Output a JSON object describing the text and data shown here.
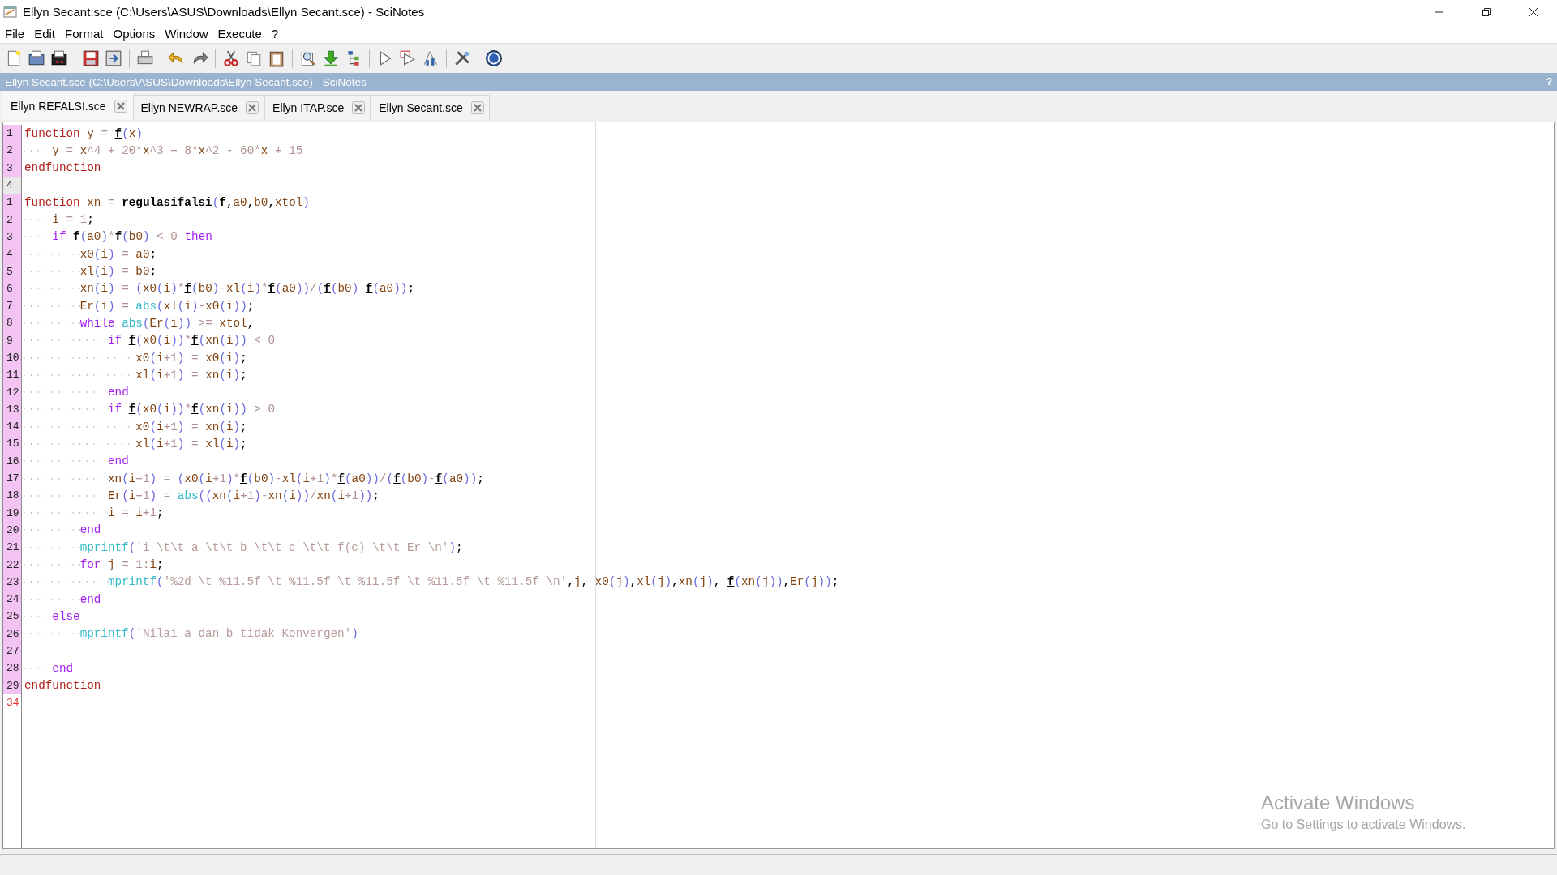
{
  "window": {
    "title": "Ellyn Secant.sce (C:\\Users\\ASUS\\Downloads\\Ellyn Secant.sce) - SciNotes"
  },
  "menu": [
    "File",
    "Edit",
    "Format",
    "Options",
    "Window",
    "Execute",
    "?"
  ],
  "info_bar": {
    "text": "Ellyn Secant.sce (C:\\Users\\ASUS\\Downloads\\Ellyn Secant.sce) - SciNotes",
    "help": "?"
  },
  "tabs": [
    {
      "label": "Ellyn REFALSI.sce",
      "selected": true
    },
    {
      "label": "Ellyn NEWRAP.sce",
      "selected": false
    },
    {
      "label": "Ellyn ITAP.sce",
      "selected": false
    },
    {
      "label": "Ellyn Secant.sce",
      "selected": false
    }
  ],
  "editor": {
    "lines": [
      {
        "number": "1",
        "kind": "normal",
        "tokens": [
          {
            "kind": "keyword",
            "text": "function "
          },
          {
            "kind": "variable",
            "text": "y"
          },
          {
            "kind": "literal",
            "text": " = "
          },
          {
            "kind": "call",
            "text": "f"
          },
          {
            "kind": "bracket",
            "text": "("
          },
          {
            "kind": "variable",
            "text": "x"
          },
          {
            "kind": "bracket",
            "text": ")"
          }
        ]
      },
      {
        "number": "2",
        "kind": "normal",
        "tokens": [
          {
            "kind": "variable",
            "text": "    y"
          },
          {
            "kind": "literal",
            "text": " = "
          },
          {
            "kind": "variable",
            "text": "x"
          },
          {
            "kind": "literal",
            "text": "^4 + 20*"
          },
          {
            "kind": "variable",
            "text": "x"
          },
          {
            "kind": "literal",
            "text": "^3 + 8*"
          },
          {
            "kind": "variable",
            "text": "x"
          },
          {
            "kind": "literal",
            "text": "^2 - 60*"
          },
          {
            "kind": "variable",
            "text": "x"
          },
          {
            "kind": "literal",
            "text": " + 15"
          }
        ]
      },
      {
        "number": "3",
        "kind": "normal",
        "tokens": [
          {
            "kind": "keyword",
            "text": "endfunction"
          }
        ]
      },
      {
        "number": "4",
        "kind": "plain"
      },
      {
        "number": "1",
        "kind": "normal",
        "tokens": [
          {
            "kind": "keyword",
            "text": "function "
          },
          {
            "kind": "variable",
            "text": "xn"
          },
          {
            "kind": "literal",
            "text": " = "
          },
          {
            "kind": "call",
            "text": "regulasifalsi"
          },
          {
            "kind": "bracket",
            "text": "("
          },
          {
            "kind": "call",
            "text": "f"
          },
          {
            "kind": "plain",
            "text": ","
          },
          {
            "kind": "variable",
            "text": "a0"
          },
          {
            "kind": "plain",
            "text": ","
          },
          {
            "kind": "variable",
            "text": "b0"
          },
          {
            "kind": "plain",
            "text": ","
          },
          {
            "kind": "variable",
            "text": "xtol"
          },
          {
            "kind": "bracket",
            "text": ")"
          }
        ]
      },
      {
        "number": "2",
        "kind": "normal",
        "tokens": [
          {
            "kind": "variable",
            "text": "    i"
          },
          {
            "kind": "literal",
            "text": " = 1"
          },
          {
            "kind": "plain",
            "text": ";"
          }
        ]
      },
      {
        "number": "3",
        "kind": "normal",
        "tokens": [
          {
            "kind": "control",
            "text": "    if "
          },
          {
            "kind": "call",
            "text": "f"
          },
          {
            "kind": "bracket",
            "text": "("
          },
          {
            "kind": "variable",
            "text": "a0"
          },
          {
            "kind": "bracket",
            "text": ")"
          },
          {
            "kind": "literal",
            "text": "*"
          },
          {
            "kind": "call",
            "text": "f"
          },
          {
            "kind": "bracket",
            "text": "("
          },
          {
            "kind": "variable",
            "text": "b0"
          },
          {
            "kind": "bracket",
            "text": ")"
          },
          {
            "kind": "literal",
            "text": " < 0 "
          },
          {
            "kind": "control",
            "text": "then"
          }
        ]
      },
      {
        "number": "4",
        "kind": "normal",
        "tokens": [
          {
            "kind": "variable",
            "text": "        x0"
          },
          {
            "kind": "bracket",
            "text": "("
          },
          {
            "kind": "variable",
            "text": "i"
          },
          {
            "kind": "bracket",
            "text": ")"
          },
          {
            "kind": "literal",
            "text": " = "
          },
          {
            "kind": "variable",
            "text": "a0"
          },
          {
            "kind": "plain",
            "text": ";"
          }
        ]
      },
      {
        "number": "5",
        "kind": "normal",
        "tokens": [
          {
            "kind": "variable",
            "text": "        xl"
          },
          {
            "kind": "bracket",
            "text": "("
          },
          {
            "kind": "variable",
            "text": "i"
          },
          {
            "kind": "bracket",
            "text": ")"
          },
          {
            "kind": "literal",
            "text": " = "
          },
          {
            "kind": "variable",
            "text": "b0"
          },
          {
            "kind": "plain",
            "text": ";"
          }
        ]
      },
      {
        "number": "6",
        "kind": "normal",
        "tokens": [
          {
            "kind": "variable",
            "text": "        xn"
          },
          {
            "kind": "bracket",
            "text": "("
          },
          {
            "kind": "variable",
            "text": "i"
          },
          {
            "kind": "bracket",
            "text": ")"
          },
          {
            "kind": "literal",
            "text": " = "
          },
          {
            "kind": "bracket",
            "text": "("
          },
          {
            "kind": "variable",
            "text": "x0"
          },
          {
            "kind": "bracket",
            "text": "("
          },
          {
            "kind": "variable",
            "text": "i"
          },
          {
            "kind": "bracket",
            "text": ")"
          },
          {
            "kind": "literal",
            "text": "*"
          },
          {
            "kind": "call",
            "text": "f"
          },
          {
            "kind": "bracket",
            "text": "("
          },
          {
            "kind": "variable",
            "text": "b0"
          },
          {
            "kind": "bracket",
            "text": ")"
          },
          {
            "kind": "literal",
            "text": "-"
          },
          {
            "kind": "variable",
            "text": "xl"
          },
          {
            "kind": "bracket",
            "text": "("
          },
          {
            "kind": "variable",
            "text": "i"
          },
          {
            "kind": "bracket",
            "text": ")"
          },
          {
            "kind": "literal",
            "text": "*"
          },
          {
            "kind": "call",
            "text": "f"
          },
          {
            "kind": "bracket",
            "text": "("
          },
          {
            "kind": "variable",
            "text": "a0"
          },
          {
            "kind": "bracket",
            "text": "))"
          },
          {
            "kind": "literal",
            "text": "/"
          },
          {
            "kind": "bracket",
            "text": "("
          },
          {
            "kind": "call",
            "text": "f"
          },
          {
            "kind": "bracket",
            "text": "("
          },
          {
            "kind": "variable",
            "text": "b0"
          },
          {
            "kind": "bracket",
            "text": ")"
          },
          {
            "kind": "literal",
            "text": "-"
          },
          {
            "kind": "call",
            "text": "f"
          },
          {
            "kind": "bracket",
            "text": "("
          },
          {
            "kind": "variable",
            "text": "a0"
          },
          {
            "kind": "bracket",
            "text": "))"
          },
          {
            "kind": "plain",
            "text": ";"
          }
        ]
      },
      {
        "number": "7",
        "kind": "normal",
        "tokens": [
          {
            "kind": "variable",
            "text": "        Er"
          },
          {
            "kind": "bracket",
            "text": "("
          },
          {
            "kind": "variable",
            "text": "i"
          },
          {
            "kind": "bracket",
            "text": ")"
          },
          {
            "kind": "literal",
            "text": " = "
          },
          {
            "kind": "builtin",
            "text": "abs"
          },
          {
            "kind": "bracket",
            "text": "("
          },
          {
            "kind": "variable",
            "text": "xl"
          },
          {
            "kind": "bracket",
            "text": "("
          },
          {
            "kind": "variable",
            "text": "i"
          },
          {
            "kind": "bracket",
            "text": ")"
          },
          {
            "kind": "literal",
            "text": "-"
          },
          {
            "kind": "variable",
            "text": "x0"
          },
          {
            "kind": "bracket",
            "text": "("
          },
          {
            "kind": "variable",
            "text": "i"
          },
          {
            "kind": "bracket",
            "text": "))"
          },
          {
            "kind": "plain",
            "text": ";"
          }
        ]
      },
      {
        "number": "8",
        "kind": "normal",
        "tokens": [
          {
            "kind": "control",
            "text": "        while "
          },
          {
            "kind": "builtin",
            "text": "abs"
          },
          {
            "kind": "bracket",
            "text": "("
          },
          {
            "kind": "variable",
            "text": "Er"
          },
          {
            "kind": "bracket",
            "text": "("
          },
          {
            "kind": "variable",
            "text": "i"
          },
          {
            "kind": "bracket",
            "text": "))"
          },
          {
            "kind": "literal",
            "text": " >= "
          },
          {
            "kind": "variable",
            "text": "xtol"
          },
          {
            "kind": "plain",
            "text": ","
          }
        ]
      },
      {
        "number": "9",
        "kind": "normal",
        "tokens": [
          {
            "kind": "control",
            "text": "            if "
          },
          {
            "kind": "call",
            "text": "f"
          },
          {
            "kind": "bracket",
            "text": "("
          },
          {
            "kind": "variable",
            "text": "x0"
          },
          {
            "kind": "bracket",
            "text": "("
          },
          {
            "kind": "variable",
            "text": "i"
          },
          {
            "kind": "bracket",
            "text": "))"
          },
          {
            "kind": "literal",
            "text": "*"
          },
          {
            "kind": "call",
            "text": "f"
          },
          {
            "kind": "bracket",
            "text": "("
          },
          {
            "kind": "variable",
            "text": "xn"
          },
          {
            "kind": "bracket",
            "text": "("
          },
          {
            "kind": "variable",
            "text": "i"
          },
          {
            "kind": "bracket",
            "text": "))"
          },
          {
            "kind": "literal",
            "text": " < 0"
          }
        ]
      },
      {
        "number": "10",
        "kind": "normal",
        "tokens": [
          {
            "kind": "variable",
            "text": "                x0"
          },
          {
            "kind": "bracket",
            "text": "("
          },
          {
            "kind": "variable",
            "text": "i"
          },
          {
            "kind": "literal",
            "text": "+1"
          },
          {
            "kind": "bracket",
            "text": ")"
          },
          {
            "kind": "literal",
            "text": " = "
          },
          {
            "kind": "variable",
            "text": "x0"
          },
          {
            "kind": "bracket",
            "text": "("
          },
          {
            "kind": "variable",
            "text": "i"
          },
          {
            "kind": "bracket",
            "text": ")"
          },
          {
            "kind": "plain",
            "text": ";"
          }
        ]
      },
      {
        "number": "11",
        "kind": "normal",
        "tokens": [
          {
            "kind": "variable",
            "text": "                xl"
          },
          {
            "kind": "bracket",
            "text": "("
          },
          {
            "kind": "variable",
            "text": "i"
          },
          {
            "kind": "literal",
            "text": "+1"
          },
          {
            "kind": "bracket",
            "text": ")"
          },
          {
            "kind": "literal",
            "text": " = "
          },
          {
            "kind": "variable",
            "text": "xn"
          },
          {
            "kind": "bracket",
            "text": "("
          },
          {
            "kind": "variable",
            "text": "i"
          },
          {
            "kind": "bracket",
            "text": ")"
          },
          {
            "kind": "plain",
            "text": ";"
          }
        ]
      },
      {
        "number": "12",
        "kind": "normal",
        "tokens": [
          {
            "kind": "control",
            "text": "            end"
          }
        ]
      },
      {
        "number": "13",
        "kind": "normal",
        "tokens": [
          {
            "kind": "control",
            "text": "            if "
          },
          {
            "kind": "call",
            "text": "f"
          },
          {
            "kind": "bracket",
            "text": "("
          },
          {
            "kind": "variable",
            "text": "x0"
          },
          {
            "kind": "bracket",
            "text": "("
          },
          {
            "kind": "variable",
            "text": "i"
          },
          {
            "kind": "bracket",
            "text": "))"
          },
          {
            "kind": "literal",
            "text": "*"
          },
          {
            "kind": "call",
            "text": "f"
          },
          {
            "kind": "bracket",
            "text": "("
          },
          {
            "kind": "variable",
            "text": "xn"
          },
          {
            "kind": "bracket",
            "text": "("
          },
          {
            "kind": "variable",
            "text": "i"
          },
          {
            "kind": "bracket",
            "text": "))"
          },
          {
            "kind": "literal",
            "text": " > 0"
          }
        ]
      },
      {
        "number": "14",
        "kind": "normal",
        "tokens": [
          {
            "kind": "variable",
            "text": "                x0"
          },
          {
            "kind": "bracket",
            "text": "("
          },
          {
            "kind": "variable",
            "text": "i"
          },
          {
            "kind": "literal",
            "text": "+1"
          },
          {
            "kind": "bracket",
            "text": ")"
          },
          {
            "kind": "literal",
            "text": " = "
          },
          {
            "kind": "variable",
            "text": "xn"
          },
          {
            "kind": "bracket",
            "text": "("
          },
          {
            "kind": "variable",
            "text": "i"
          },
          {
            "kind": "bracket",
            "text": ")"
          },
          {
            "kind": "plain",
            "text": ";"
          }
        ]
      },
      {
        "number": "15",
        "kind": "normal",
        "tokens": [
          {
            "kind": "variable",
            "text": "                xl"
          },
          {
            "kind": "bracket",
            "text": "("
          },
          {
            "kind": "variable",
            "text": "i"
          },
          {
            "kind": "literal",
            "text": "+1"
          },
          {
            "kind": "bracket",
            "text": ")"
          },
          {
            "kind": "literal",
            "text": " = "
          },
          {
            "kind": "variable",
            "text": "xl"
          },
          {
            "kind": "bracket",
            "text": "("
          },
          {
            "kind": "variable",
            "text": "i"
          },
          {
            "kind": "bracket",
            "text": ")"
          },
          {
            "kind": "plain",
            "text": ";"
          }
        ]
      },
      {
        "number": "16",
        "kind": "normal",
        "tokens": [
          {
            "kind": "control",
            "text": "            end"
          }
        ]
      },
      {
        "number": "17",
        "kind": "normal",
        "tokens": [
          {
            "kind": "variable",
            "text": "            xn"
          },
          {
            "kind": "bracket",
            "text": "("
          },
          {
            "kind": "variable",
            "text": "i"
          },
          {
            "kind": "literal",
            "text": "+1"
          },
          {
            "kind": "bracket",
            "text": ")"
          },
          {
            "kind": "literal",
            "text": " = "
          },
          {
            "kind": "bracket",
            "text": "("
          },
          {
            "kind": "variable",
            "text": "x0"
          },
          {
            "kind": "bracket",
            "text": "("
          },
          {
            "kind": "variable",
            "text": "i"
          },
          {
            "kind": "literal",
            "text": "+1"
          },
          {
            "kind": "bracket",
            "text": ")"
          },
          {
            "kind": "literal",
            "text": "*"
          },
          {
            "kind": "call",
            "text": "f"
          },
          {
            "kind": "bracket",
            "text": "("
          },
          {
            "kind": "variable",
            "text": "b0"
          },
          {
            "kind": "bracket",
            "text": ")"
          },
          {
            "kind": "literal",
            "text": "-"
          },
          {
            "kind": "variable",
            "text": "xl"
          },
          {
            "kind": "bracket",
            "text": "("
          },
          {
            "kind": "variable",
            "text": "i"
          },
          {
            "kind": "literal",
            "text": "+1"
          },
          {
            "kind": "bracket",
            "text": ")"
          },
          {
            "kind": "literal",
            "text": "*"
          },
          {
            "kind": "call",
            "text": "f"
          },
          {
            "kind": "bracket",
            "text": "("
          },
          {
            "kind": "variable",
            "text": "a0"
          },
          {
            "kind": "bracket",
            "text": "))"
          },
          {
            "kind": "literal",
            "text": "/"
          },
          {
            "kind": "bracket",
            "text": "("
          },
          {
            "kind": "call",
            "text": "f"
          },
          {
            "kind": "bracket",
            "text": "("
          },
          {
            "kind": "variable",
            "text": "b0"
          },
          {
            "kind": "bracket",
            "text": ")"
          },
          {
            "kind": "literal",
            "text": "-"
          },
          {
            "kind": "call",
            "text": "f"
          },
          {
            "kind": "bracket",
            "text": "("
          },
          {
            "kind": "variable",
            "text": "a0"
          },
          {
            "kind": "bracket",
            "text": "))"
          },
          {
            "kind": "plain",
            "text": ";"
          }
        ]
      },
      {
        "number": "18",
        "kind": "normal",
        "tokens": [
          {
            "kind": "variable",
            "text": "            Er"
          },
          {
            "kind": "bracket",
            "text": "("
          },
          {
            "kind": "variable",
            "text": "i"
          },
          {
            "kind": "literal",
            "text": "+1"
          },
          {
            "kind": "bracket",
            "text": ")"
          },
          {
            "kind": "literal",
            "text": " = "
          },
          {
            "kind": "builtin",
            "text": "abs"
          },
          {
            "kind": "bracket",
            "text": "(("
          },
          {
            "kind": "variable",
            "text": "xn"
          },
          {
            "kind": "bracket",
            "text": "("
          },
          {
            "kind": "variable",
            "text": "i"
          },
          {
            "kind": "literal",
            "text": "+1"
          },
          {
            "kind": "bracket",
            "text": ")"
          },
          {
            "kind": "literal",
            "text": "-"
          },
          {
            "kind": "variable",
            "text": "xn"
          },
          {
            "kind": "bracket",
            "text": "("
          },
          {
            "kind": "variable",
            "text": "i"
          },
          {
            "kind": "bracket",
            "text": "))"
          },
          {
            "kind": "literal",
            "text": "/"
          },
          {
            "kind": "variable",
            "text": "xn"
          },
          {
            "kind": "bracket",
            "text": "("
          },
          {
            "kind": "variable",
            "text": "i"
          },
          {
            "kind": "literal",
            "text": "+1"
          },
          {
            "kind": "bracket",
            "text": "))"
          },
          {
            "kind": "plain",
            "text": ";"
          }
        ]
      },
      {
        "number": "19",
        "kind": "normal",
        "tokens": [
          {
            "kind": "variable",
            "text": "            i"
          },
          {
            "kind": "literal",
            "text": " = "
          },
          {
            "kind": "variable",
            "text": "i"
          },
          {
            "kind": "literal",
            "text": "+1"
          },
          {
            "kind": "plain",
            "text": ";"
          }
        ]
      },
      {
        "number": "20",
        "kind": "normal",
        "tokens": [
          {
            "kind": "control",
            "text": "        end"
          }
        ]
      },
      {
        "number": "21",
        "kind": "normal",
        "tokens": [
          {
            "kind": "builtin",
            "text": "        mprintf"
          },
          {
            "kind": "bracket",
            "text": "("
          },
          {
            "kind": "string",
            "text": "'i \\t\\t a \\t\\t b \\t\\t c \\t\\t f(c) \\t\\t Er \\n'"
          },
          {
            "kind": "bracket",
            "text": ")"
          },
          {
            "kind": "plain",
            "text": ";"
          }
        ]
      },
      {
        "number": "22",
        "kind": "normal",
        "tokens": [
          {
            "kind": "control",
            "text": "        for "
          },
          {
            "kind": "variable",
            "text": "j"
          },
          {
            "kind": "literal",
            "text": " = 1:"
          },
          {
            "kind": "variable",
            "text": "i"
          },
          {
            "kind": "plain",
            "text": ";"
          }
        ]
      },
      {
        "number": "23",
        "kind": "normal",
        "tokens": [
          {
            "kind": "builtin",
            "text": "            mprintf"
          },
          {
            "kind": "bracket",
            "text": "("
          },
          {
            "kind": "string",
            "text": "'%2d \\t %11.5f \\t %11.5f \\t %11.5f \\t %11.5f \\t %11.5f \\n'"
          },
          {
            "kind": "plain",
            "text": ","
          },
          {
            "kind": "variable",
            "text": "j"
          },
          {
            "kind": "plain",
            "text": ", "
          },
          {
            "kind": "variable",
            "text": "x0"
          },
          {
            "kind": "bracket",
            "text": "("
          },
          {
            "kind": "variable",
            "text": "j"
          },
          {
            "kind": "bracket",
            "text": ")"
          },
          {
            "kind": "plain",
            "text": ","
          },
          {
            "kind": "variable",
            "text": "xl"
          },
          {
            "kind": "bracket",
            "text": "("
          },
          {
            "kind": "variable",
            "text": "j"
          },
          {
            "kind": "bracket",
            "text": ")"
          },
          {
            "kind": "plain",
            "text": ","
          },
          {
            "kind": "variable",
            "text": "xn"
          },
          {
            "kind": "bracket",
            "text": "("
          },
          {
            "kind": "variable",
            "text": "j"
          },
          {
            "kind": "bracket",
            "text": ")"
          },
          {
            "kind": "plain",
            "text": ", "
          },
          {
            "kind": "call",
            "text": "f"
          },
          {
            "kind": "bracket",
            "text": "("
          },
          {
            "kind": "variable",
            "text": "xn"
          },
          {
            "kind": "bracket",
            "text": "("
          },
          {
            "kind": "variable",
            "text": "j"
          },
          {
            "kind": "bracket",
            "text": "))"
          },
          {
            "kind": "plain",
            "text": ","
          },
          {
            "kind": "variable",
            "text": "Er"
          },
          {
            "kind": "bracket",
            "text": "("
          },
          {
            "kind": "variable",
            "text": "j"
          },
          {
            "kind": "bracket",
            "text": "))"
          },
          {
            "kind": "plain",
            "text": ";"
          }
        ]
      },
      {
        "number": "24",
        "kind": "normal",
        "tokens": [
          {
            "kind": "control",
            "text": "        end"
          }
        ]
      },
      {
        "number": "25",
        "kind": "normal",
        "tokens": [
          {
            "kind": "control",
            "text": "    else"
          }
        ]
      },
      {
        "number": "26",
        "kind": "normal",
        "tokens": [
          {
            "kind": "builtin",
            "text": "        mprintf"
          },
          {
            "kind": "bracket",
            "text": "("
          },
          {
            "kind": "string",
            "text": "'Nilai a dan b tidak Konvergen'"
          },
          {
            "kind": "bracket",
            "text": ")"
          }
        ]
      },
      {
        "number": "27",
        "kind": "normal"
      },
      {
        "number": "28",
        "kind": "normal",
        "tokens": [
          {
            "kind": "control",
            "text": "    end"
          }
        ]
      },
      {
        "number": "29",
        "kind": "normal",
        "tokens": [
          {
            "kind": "keyword",
            "text": "endfunction"
          }
        ]
      },
      {
        "number": "34",
        "kind": "active"
      }
    ]
  },
  "activation_notice": {
    "title": "Activate Windows",
    "text": "Go to Settings to activate Windows."
  }
}
